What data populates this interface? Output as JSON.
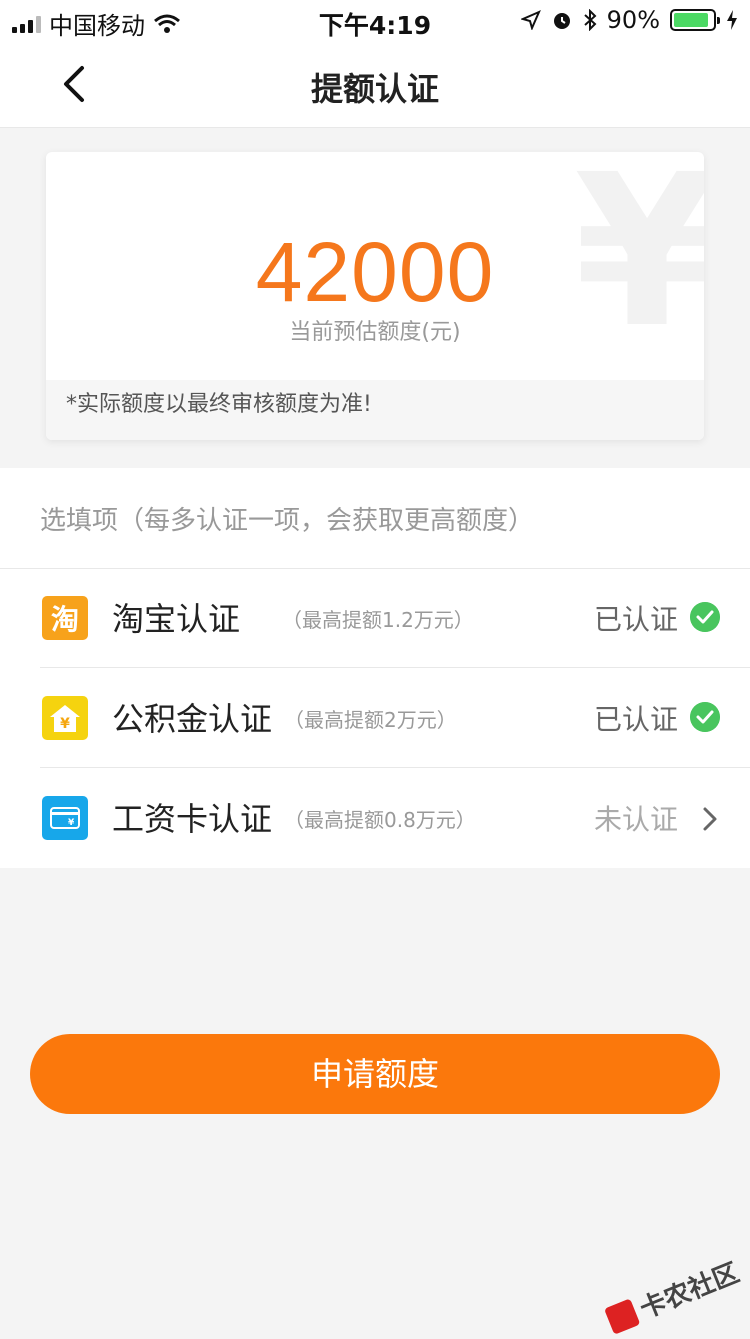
{
  "status_bar": {
    "carrier": "中国移动",
    "time": "下午4:19",
    "battery_percent": "90%",
    "battery_level": 0.9,
    "icons": [
      "signal-icon",
      "wifi-icon",
      "location-icon",
      "alarm-icon",
      "bluetooth-icon",
      "battery-icon",
      "charging-icon"
    ]
  },
  "nav": {
    "title": "提额认证",
    "back_icon": "chevron-left-icon"
  },
  "quota": {
    "amount": "42000",
    "label": "当前预估额度(元)",
    "note": "*实际额度以最终审核额度为准!",
    "watermark_symbol": "¥",
    "accent_color": "#f5771c"
  },
  "optional": {
    "header": "选填项（每多认证一项，会获取更高额度）",
    "items": [
      {
        "name": "淘宝认证",
        "limit": "（最高提额1.2万元）",
        "status": "已认证",
        "icon": "taobao-icon",
        "icon_glyph": "淘",
        "icon_color": "#f7a21b",
        "verified": true
      },
      {
        "name": "公积金认证",
        "limit": "（最高提额2万元）",
        "status": "已认证",
        "icon": "house-fund-icon",
        "icon_color": "#f5d30f",
        "verified": true
      },
      {
        "name": "工资卡认证",
        "limit": "（最高提额0.8万元）",
        "status": "未认证",
        "icon": "salary-card-icon",
        "icon_color": "#17a7ea",
        "verified": false
      }
    ]
  },
  "actions": {
    "apply_label": "申请额度",
    "button_color": "#fb780c"
  },
  "watermark": {
    "text": "卡农社区"
  }
}
